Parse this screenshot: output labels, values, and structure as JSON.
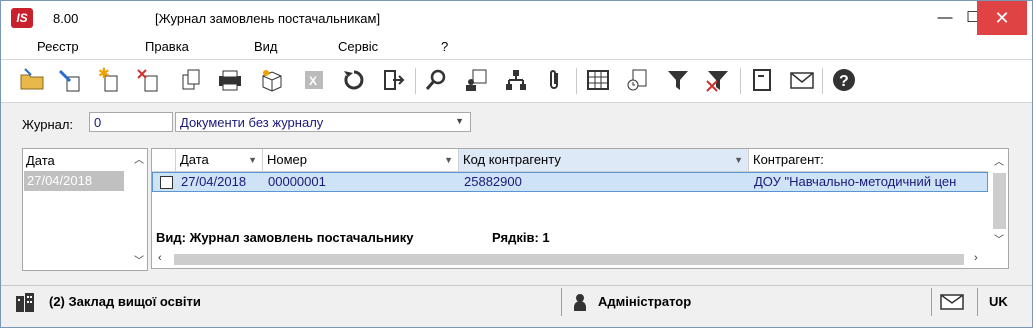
{
  "titlebar": {
    "logo": "IS",
    "version": "8.00",
    "title": "[Журнал замовлень постачальникам]",
    "minimize": "—",
    "maximize": "☐",
    "close": "✕"
  },
  "menu": [
    "Реєстр",
    "Правка",
    "Вид",
    "Сервіс",
    "?"
  ],
  "toolbar": {
    "icons": [
      "open-folder-icon",
      "edit-icon",
      "new-document-icon",
      "delete-icon",
      "copy-icon",
      "print-icon",
      "package-icon",
      "export-excel-icon",
      "refresh-icon",
      "exit-icon",
      "search-icon",
      "user-card-icon",
      "hierarchy-icon",
      "attachment-icon",
      "table-icon",
      "document-clock-icon",
      "filter-icon",
      "clear-filter-icon",
      "document-icon",
      "mail-icon",
      "help-icon"
    ]
  },
  "journal": {
    "label": "Журнал:",
    "number": "0",
    "selected": "Документи без журналу"
  },
  "date_panel": {
    "header": "Дата",
    "rows": [
      "27/04/2018"
    ]
  },
  "grid": {
    "columns": [
      "Дата",
      "Номер",
      "Код контрагенту",
      "Контрагент:"
    ],
    "rows": [
      [
        "27/04/2018",
        "00000001",
        "25882900",
        "ДОУ \"Навчально-методичний цен"
      ]
    ],
    "footer_view": "Вид: Журнал замовлень постачальнику",
    "footer_count": "Рядків: 1"
  },
  "status": {
    "organization": "(2) Заклад вищої освіти",
    "user": "Адміністратор",
    "language": "UK"
  },
  "colors": {
    "close_button": "#e04343",
    "selected_row": "#cfe3f7",
    "logo": "#c8202c",
    "text_value": "#1a1a7a"
  }
}
